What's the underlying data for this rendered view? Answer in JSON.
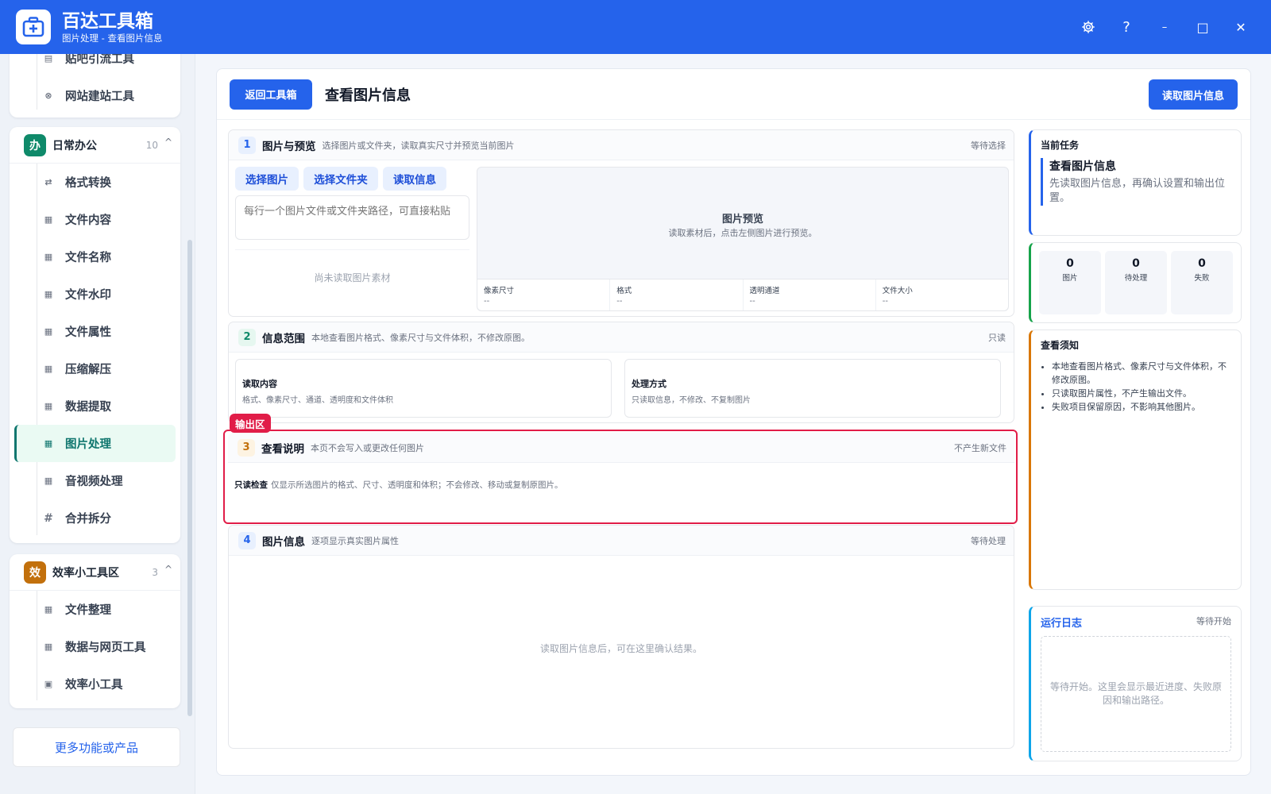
{
  "app": {
    "title": "百达工具箱",
    "subtitle": "图片处理 - 查看图片信息"
  },
  "window_controls": {
    "settings_icon": "gear-icon",
    "help_label": "?",
    "minimize_label": "–",
    "maximize_label": "□",
    "close_label": "✕"
  },
  "sidebar": {
    "top_items": [
      {
        "label": "贴吧引流工具",
        "icon": "doc-icon"
      },
      {
        "label": "网站建站工具",
        "icon": "globe-icon"
      }
    ],
    "office": {
      "badge": "办",
      "title": "日常办公",
      "count": "10",
      "items": [
        {
          "label": "格式转换",
          "icon": "swap-icon"
        },
        {
          "label": "文件内容",
          "icon": "grid-icon"
        },
        {
          "label": "文件名称",
          "icon": "grid-icon"
        },
        {
          "label": "文件水印",
          "icon": "grid-icon"
        },
        {
          "label": "文件属性",
          "icon": "grid-icon"
        },
        {
          "label": "压缩解压",
          "icon": "grid-icon"
        },
        {
          "label": "数据提取",
          "icon": "grid-icon"
        },
        {
          "label": "图片处理",
          "icon": "grid-icon",
          "active": true
        },
        {
          "label": "音视频处理",
          "icon": "grid-icon"
        },
        {
          "label": "合并拆分",
          "icon": "hash-icon"
        }
      ]
    },
    "efficiency": {
      "badge": "效",
      "title": "效率小工具区",
      "count": "3",
      "items": [
        {
          "label": "文件整理",
          "icon": "grid-icon"
        },
        {
          "label": "数据与网页工具",
          "icon": "grid-icon"
        },
        {
          "label": "效率小工具",
          "icon": "briefcase-icon"
        }
      ]
    },
    "more_label": "更多功能或产品"
  },
  "main": {
    "back_label": "返回工具箱",
    "page_title": "查看图片信息",
    "read_label": "读取图片信息",
    "sections": {
      "s1": {
        "num": "1",
        "title": "图片与预览",
        "desc": "选择图片或文件夹，读取真实尺寸并预览当前图片",
        "status": "等待选择",
        "btn_select_image": "选择图片",
        "btn_select_folder": "选择文件夹",
        "btn_read_info": "读取信息",
        "path_placeholder": "每行一个图片文件或文件夹路径，可直接粘贴",
        "empty_note": "尚未读取图片素材",
        "preview_title": "图片预览",
        "preview_sub": "读取素材后，点击左侧图片进行预览。",
        "meta": [
          {
            "k": "像素尺寸",
            "v": "--"
          },
          {
            "k": "格式",
            "v": "--"
          },
          {
            "k": "透明通道",
            "v": "--"
          },
          {
            "k": "文件大小",
            "v": "--"
          }
        ]
      },
      "s2": {
        "num": "2",
        "title": "信息范围",
        "desc": "本地查看图片格式、像素尺寸与文件体积，不修改原图。",
        "status": "只读",
        "card1_title": "读取内容",
        "card1_desc": "格式、像素尺寸、通道、透明度和文件体积",
        "card2_title": "处理方式",
        "card2_desc": "只读取信息，不修改、不复制图片"
      },
      "s3": {
        "tag": "输出区",
        "num": "3",
        "title": "查看说明",
        "desc": "本页不会写入或更改任何图片",
        "status": "不产生新文件",
        "text_bold": "只读检查",
        "text": "仅显示所选图片的格式、尺寸、透明度和体积；不会修改、移动或复制原图片。"
      },
      "s4": {
        "num": "4",
        "title": "图片信息",
        "desc": "逐项显示真实图片属性",
        "status": "等待处理",
        "empty": "读取图片信息后，可在这里确认结果。"
      }
    }
  },
  "right": {
    "task_label": "当前任务",
    "task_title": "查看图片信息",
    "task_desc": "先读取图片信息，再确认设置和输出位置。",
    "stats": [
      {
        "value": "0",
        "label": "图片"
      },
      {
        "value": "0",
        "label": "待处理"
      },
      {
        "value": "0",
        "label": "失败"
      }
    ],
    "notice_title": "查看须知",
    "notices": [
      "本地查看图片格式、像素尺寸与文件体积，不修改原图。",
      "只读取图片属性，不产生输出文件。",
      "失败项目保留原因，不影响其他图片。"
    ],
    "log_title": "运行日志",
    "log_status": "等待开始",
    "log_empty": "等待开始。这里会显示最近进度、失败原因和输出路径。"
  },
  "colors": {
    "brand": "#2563eb",
    "office_badge": "#0f8a6a",
    "efficiency_badge": "#c2700c",
    "output_border": "#e11d48"
  }
}
